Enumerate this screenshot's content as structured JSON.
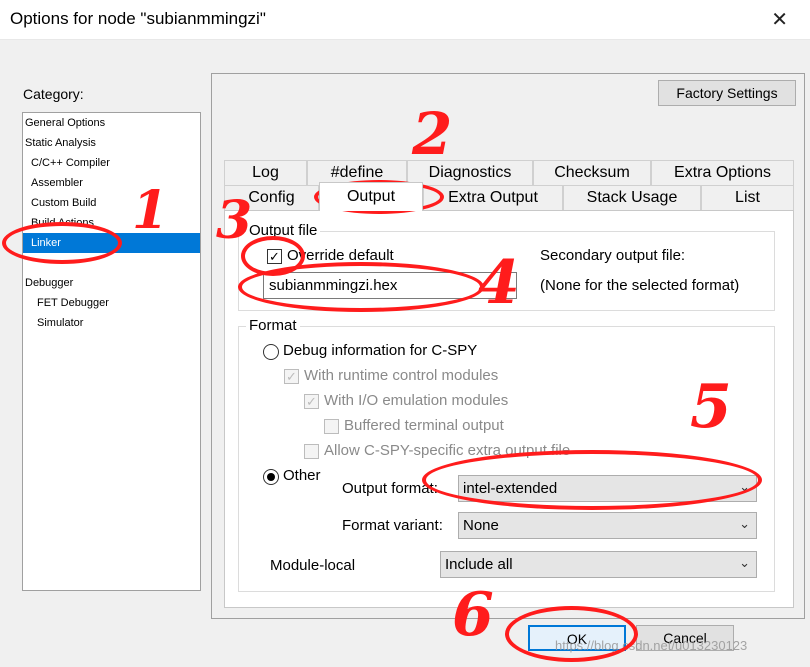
{
  "window": {
    "title": "Options for node \"subianmmingzi\"",
    "close_glyph": "✕"
  },
  "category": {
    "label": "Category:",
    "items": [
      {
        "label": "General Options",
        "level": 0
      },
      {
        "label": "Static Analysis",
        "level": 0
      },
      {
        "label": "C/C++ Compiler",
        "level": 1
      },
      {
        "label": "Assembler",
        "level": 1
      },
      {
        "label": "Custom Build",
        "level": 1
      },
      {
        "label": "Build Actions",
        "level": 1
      },
      {
        "label": "Linker",
        "level": 1,
        "selected": true
      },
      {
        "label": "Debugger",
        "level": 0
      },
      {
        "label": "FET Debugger",
        "level": 2
      },
      {
        "label": "Simulator",
        "level": 2
      }
    ]
  },
  "factory_settings": "Factory Settings",
  "tabs_row1": [
    "Log",
    "#define",
    "Diagnostics",
    "Checksum",
    "Extra Options"
  ],
  "tabs_row2": [
    "Config",
    "Output",
    "Extra Output",
    "Stack Usage",
    "List"
  ],
  "active_tab": "Output",
  "output_file": {
    "legend": "Output file",
    "override_label": "Override default",
    "override_checked": true,
    "filename": "subianmmingzi.hex",
    "secondary_label": "Secondary output file:",
    "secondary_value": "(None for the selected format)"
  },
  "format": {
    "legend": "Format",
    "debug_radio": "Debug information for C-SPY",
    "runtime_modules": "With runtime control modules",
    "io_modules": "With I/O emulation modules",
    "buffered": "Buffered terminal output",
    "allow_cspy": "Allow C-SPY-specific extra output file",
    "other_radio": "Other",
    "output_format_label": "Output format:",
    "output_format_value": "intel-extended",
    "format_variant_label": "Format variant:",
    "format_variant_value": "None",
    "module_local_label": "Module-local",
    "module_local_value": "Include all"
  },
  "buttons": {
    "ok": "OK",
    "cancel": "Cancel"
  },
  "annotations": [
    "1",
    "2",
    "3",
    "4",
    "5",
    "6"
  ],
  "watermark": "https://blog.csdn.net/u013230123",
  "colors": {
    "selection": "#0078d7",
    "annotation": "#ff1c1c"
  }
}
